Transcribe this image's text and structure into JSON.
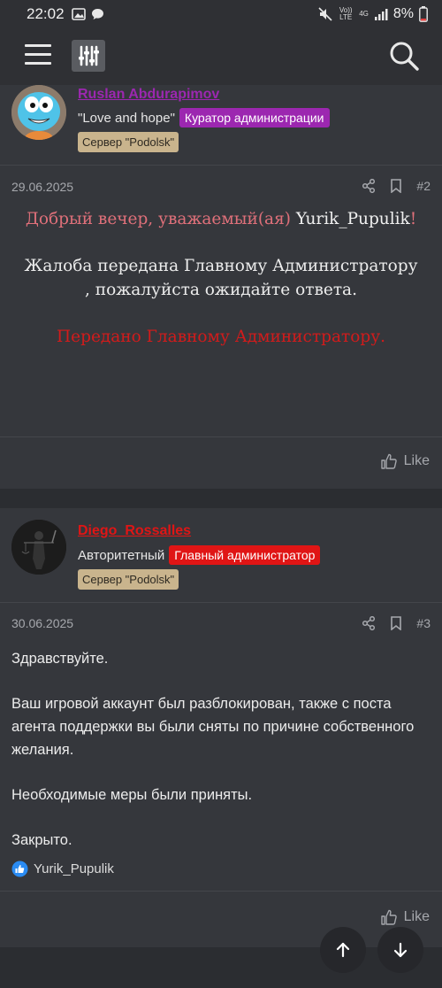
{
  "status_bar": {
    "time": "22:02",
    "volte": "Vo)) LTE",
    "network": "4G",
    "battery": "8%"
  },
  "post1": {
    "username": "Ruslan Abdurapimov",
    "user_title": "\"Love and hope\"",
    "role_badge": "Куратор администрации",
    "server_badge": "Сервер \"Podolsk\"",
    "date": "29.06.2025",
    "number": "#2",
    "greeting_prefix": "Добрый вечер, уважаемый(ая) ",
    "greeting_name": "Yurik_Pupulik",
    "greeting_suffix": "!",
    "line2": "Жалоба передана Главному Администратору , пожалуйста ожидайте ответа.",
    "line3": "Передано Главному Администратору.",
    "like_label": "Like"
  },
  "post2": {
    "username": "Diego_Rossalles",
    "user_title": "Авторитетный",
    "role_badge": "Главный администратор",
    "server_badge": "Сервер \"Podolsk\"",
    "date": "30.06.2025",
    "number": "#3",
    "p1": "Здравствуйте.",
    "p2": "Ваш игровой аккаунт был разблокирован, также с поста агента поддержки вы были сняты по причине собственного желания.",
    "p3": "Необходимые меры были приняты.",
    "p4": "Закрыто.",
    "reaction_user": "Yurik_Pupulik",
    "like_label": "Like"
  },
  "colors": {
    "background": "#2b2d31",
    "post_background": "#35373c",
    "curator_purple": "#9c27b0",
    "admin_red": "#e01515",
    "server_badge": "#c9b48d",
    "greeting_pink": "#e0707a",
    "forwarded_red": "#d21b1b"
  },
  "icons": [
    "menu-icon",
    "filter-icon",
    "search-icon",
    "share-icon",
    "bookmark-icon",
    "like-icon",
    "arrow-up-icon",
    "arrow-down-icon"
  ]
}
